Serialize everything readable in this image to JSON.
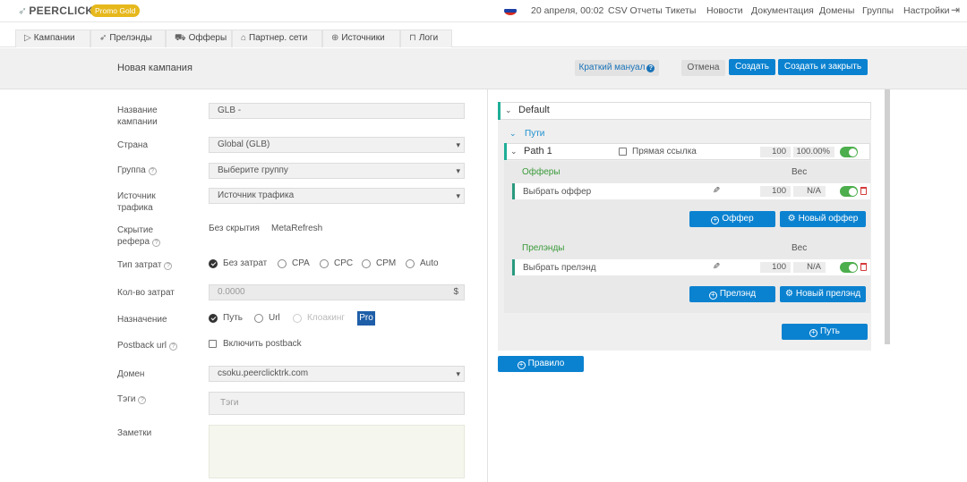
{
  "topbar": {
    "logo": "PEERCLICK",
    "promo_badge": "Promo Gold",
    "datetime": "20 апреля, 00:02",
    "nav": [
      "CSV Отчеты",
      "Тикеты",
      "Новости",
      "Документация",
      "Домены",
      "Группы",
      "Настройки"
    ],
    "flag_colors": [
      "#ffffff",
      "#1c3fa6",
      "#d52b1e"
    ]
  },
  "tabs": [
    {
      "label": "Кампании",
      "icon": "play-icon"
    },
    {
      "label": "Прелэнды",
      "icon": "send-icon"
    },
    {
      "label": "Офферы",
      "icon": "cart-icon"
    },
    {
      "label": "Партнер. сети",
      "icon": "home-icon"
    },
    {
      "label": "Источники",
      "icon": "crosshair-icon"
    },
    {
      "label": "Логи",
      "icon": "lock-icon"
    }
  ],
  "header": {
    "title": "Новая кампания",
    "manual_label": "Краткий мануал",
    "cancel_label": "Отмена",
    "create_label": "Создать",
    "create_close_label": "Создать и закрыть"
  },
  "form": {
    "name_label": "Название кампании",
    "name_value": "GLB -",
    "country_label": "Страна",
    "country_value": "Global (GLB)",
    "group_label": "Группа",
    "group_value": "Выберите группу",
    "source_label": "Источник трафика",
    "source_value": "Источник трафика",
    "referer_label": "Скрытие рефера",
    "referer_options": [
      "Без скрытия",
      "MetaRefresh"
    ],
    "cost_type_label": "Тип затрат",
    "cost_types": [
      "Без затрат",
      "CPA",
      "CPC",
      "CPM",
      "Auto"
    ],
    "cost_amount_label": "Кол-во затрат",
    "cost_amount_value": "0.0000",
    "currency": "$",
    "dest_label": "Назначение",
    "dest_options": [
      "Путь",
      "Url",
      "Клоакинг"
    ],
    "pro_badge": "Pro",
    "postback_label": "Postback url",
    "postback_checkbox": "Включить postback",
    "domain_label": "Домен",
    "domain_value": "csoku.peerclicktrk.com",
    "tags_label": "Тэги",
    "tags_placeholder": "Тэги",
    "notes_label": "Заметки"
  },
  "flow": {
    "default_label": "Default",
    "paths_label": "Пути",
    "path_name": "Path 1",
    "direct_link_label": "Прямая ссылка",
    "path_weight": "100",
    "path_share": "100.00%",
    "offers_label": "Офферы",
    "weight_label": "Вес",
    "offer_select": "Выбрать оффер",
    "offer_weight": "100",
    "offer_share": "N/A",
    "offer_btn": "Оффер",
    "new_offer_btn": "Новый оффер",
    "landers_label": "Прелэнды",
    "lander_select": "Выбрать прелэнд",
    "lander_weight": "100",
    "lander_share": "N/A",
    "lander_btn": "Прелэнд",
    "new_lander_btn": "Новый прелэнд",
    "path_btn": "Путь",
    "rule_btn": "Правило"
  }
}
